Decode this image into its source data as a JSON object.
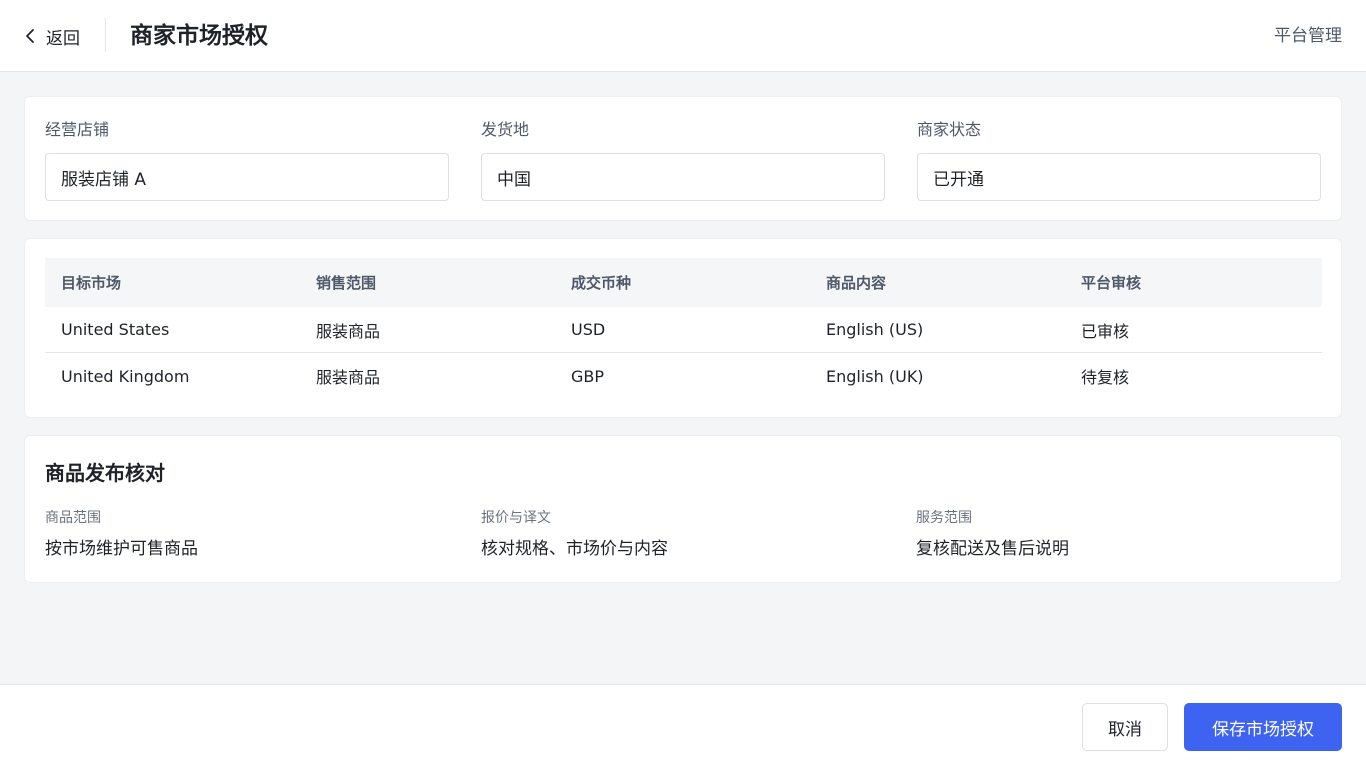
{
  "header": {
    "back_label": "返回",
    "title": "商家市场授权",
    "platform_link": "平台管理"
  },
  "fields": {
    "store": {
      "label": "经营店铺",
      "value": "服装店铺 A"
    },
    "origin": {
      "label": "发货地",
      "value": "中国"
    },
    "status": {
      "label": "商家状态",
      "value": "已开通"
    }
  },
  "table": {
    "headers": [
      "目标市场",
      "销售范围",
      "成交币种",
      "商品内容",
      "平台审核"
    ],
    "rows": [
      [
        "United States",
        "服装商品",
        "USD",
        "English (US)",
        "已审核"
      ],
      [
        "United Kingdom",
        "服装商品",
        "GBP",
        "English (UK)",
        "待复核"
      ]
    ]
  },
  "check": {
    "title": "商品发布核对",
    "items": [
      {
        "label": "商品范围",
        "value": "按市场维护可售商品"
      },
      {
        "label": "报价与译文",
        "value": "核对规格、市场价与内容"
      },
      {
        "label": "服务范围",
        "value": "复核配送及售后说明"
      }
    ]
  },
  "footer": {
    "cancel_label": "取消",
    "save_label": "保存市场授权"
  },
  "colors": {
    "primary": "#3d63f0",
    "background": "#f4f5f7",
    "table_header": "#f5f6f8"
  }
}
